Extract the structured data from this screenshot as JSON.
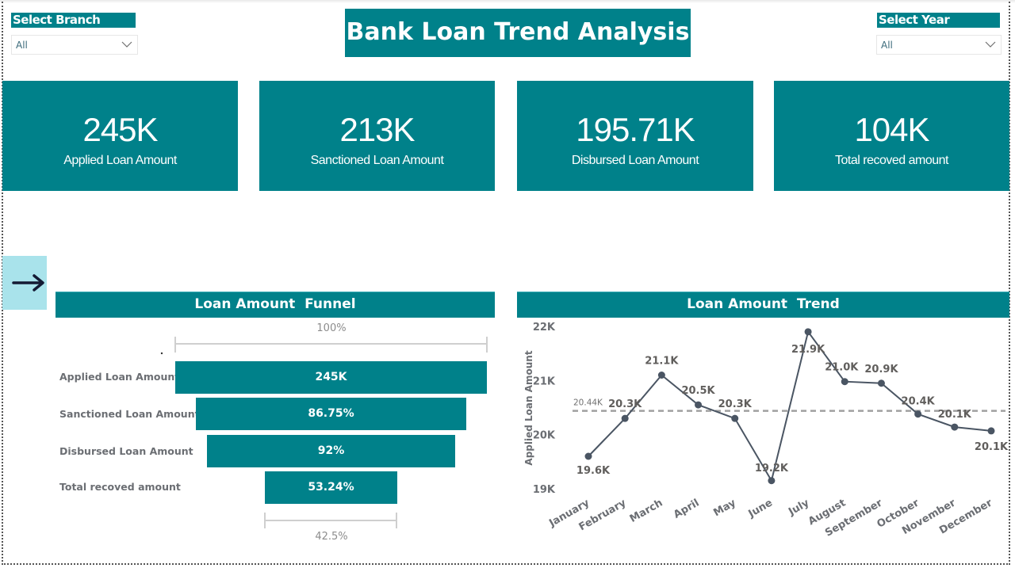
{
  "colors": {
    "accent": "#00818a",
    "nav_button": "#a9e3eb",
    "line": "#4a5563",
    "axis_text": "#6b6e73",
    "ref_line": "#a0a0a0"
  },
  "filters": {
    "branch": {
      "label": "Select Branch",
      "value": "All"
    },
    "year": {
      "label": "Select Year",
      "value": "All"
    }
  },
  "header": {
    "title": "Bank Loan Trend Analysis"
  },
  "kpis": [
    {
      "value": "245K",
      "label": "Applied Loan Amount"
    },
    {
      "value": "213K",
      "label": "Sanctioned Loan Amount"
    },
    {
      "value": "195.71K",
      "label": "Disbursed Loan Amount"
    },
    {
      "value": "104K",
      "label": "Total recoved amount"
    }
  ],
  "nav": {
    "icon": "arrow-right-icon",
    "glyph": "→"
  },
  "funnel": {
    "title": "Loan Amount  Funnel",
    "top_note": "100%",
    "bottom_note": "42.5%",
    "stages": [
      {
        "label": "Applied Loan Amount",
        "display": "245K",
        "fraction": 1.0
      },
      {
        "label": "Sanctioned Loan Amount",
        "display": "86.75%",
        "fraction": 0.8675
      },
      {
        "label": "Disbursed Loan Amount",
        "display": "92%",
        "fraction": 0.798
      },
      {
        "label": "Total recoved amount",
        "display": "53.24%",
        "fraction": 0.425
      }
    ]
  },
  "trend": {
    "title": "Loan Amount  Trend"
  },
  "chart_data": {
    "type": "line",
    "title": "Loan Amount  Trend",
    "xlabel": "",
    "ylabel": "Applied Loan Amount",
    "categories": [
      "January",
      "February",
      "March",
      "April",
      "May",
      "June",
      "July",
      "August",
      "September",
      "October",
      "November",
      "December"
    ],
    "series": [
      {
        "name": "Applied Loan Amount",
        "values": [
          19600,
          20300,
          21100,
          20550,
          20300,
          19150,
          21900,
          20980,
          20950,
          20380,
          20140,
          20070
        ],
        "labels": [
          "19.6K",
          "20.3K",
          "21.1K",
          "20.5K",
          "20.3K",
          "19.2K",
          "21.9K",
          "21.0K",
          "20.9K",
          "20.4K",
          "20.1K",
          "20.1K"
        ]
      }
    ],
    "reference_line": {
      "value": 20440,
      "label": "20.44K",
      "style": "dashed"
    },
    "yticks": [
      19000,
      20000,
      21000,
      22000
    ],
    "ytick_labels": [
      "19K",
      "20K",
      "21K",
      "22K"
    ],
    "ylim": [
      19000,
      22000
    ],
    "grid": false,
    "legend": "none"
  }
}
